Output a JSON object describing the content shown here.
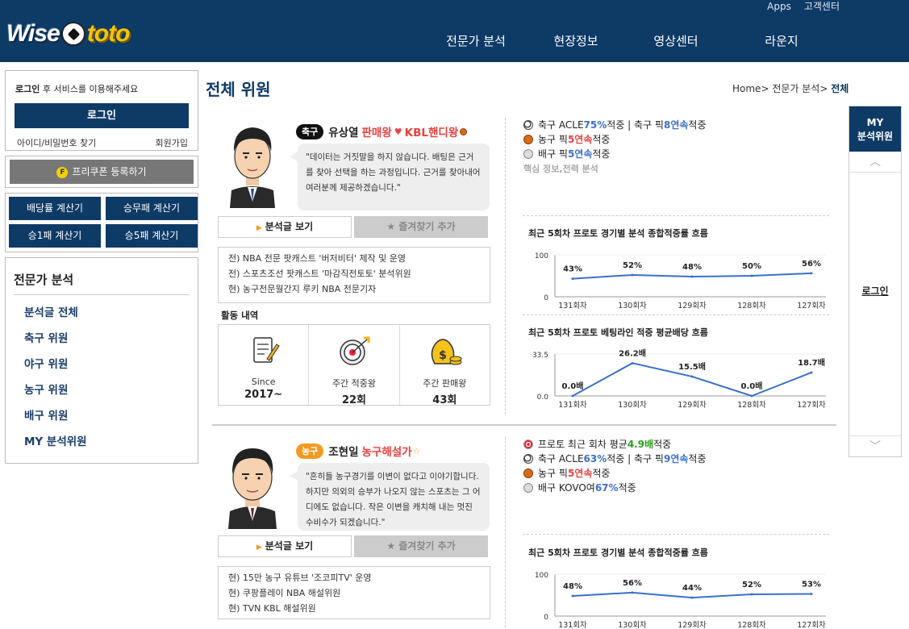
{
  "header": {
    "logo_left": "Wise",
    "logo_right": "toto",
    "top_links": [
      "Apps",
      "고객센터"
    ],
    "nav": [
      "전문가 분석",
      "현장정보",
      "영상센터",
      "라운지"
    ]
  },
  "sidebar": {
    "login_msg_bold": "로그인",
    "login_msg_rest": " 후 서비스를 이용해주세요",
    "login_button": "로그인",
    "find_id": "아이디/비밀번호 찾기",
    "join": "회원가입",
    "coupon_icon": "F",
    "coupon_label": "프리쿠폰 등록하기",
    "calculators": [
      "배당률 계산기",
      "승무패 계산기",
      "승1패 계산기",
      "승5패 계산기"
    ],
    "menu_title": "전문가 분석",
    "menu_items": [
      "분석글 전체",
      "축구 위원",
      "야구 위원",
      "농구 위원",
      "배구 위원",
      "MY 분석위원"
    ]
  },
  "page": {
    "title": "전체 위원",
    "breadcrumb_home": "Home",
    "breadcrumb_mid": "전문가 분석",
    "breadcrumb_current": "전체"
  },
  "my_panel": {
    "title_line1": "MY",
    "title_line2": "분석위원",
    "login": "로그인",
    "up": "︿",
    "down": "﹀"
  },
  "experts": [
    {
      "category": "축구",
      "name": "유상열",
      "tag1": "판매왕",
      "tag2": "KBL핸디왕",
      "quote": "\"데이터는 거짓말을 하지 않습니다. 배팅은 근거를 찾아 선택을 하는 과정입니다. 근거를 찾아내어 여러분께 제공하겠습니다.\"",
      "view_button": "분석글 보기",
      "fav_button": "즐겨찾기 추가",
      "career": [
        "전) NBA 전문 팟캐스트 '버저비터' 제작 및 운영",
        "전) 스포츠조선 팟캐스트 '마감직전토토' 분석위원",
        "현) 농구전문월간지 루키 NBA 전문기자"
      ],
      "activity_title": "활동 내역",
      "activity": [
        {
          "icon": "document-icon",
          "label": "Since",
          "value": "2017~"
        },
        {
          "icon": "target-icon",
          "label": "주간 적중왕",
          "value": "22회"
        },
        {
          "icon": "moneybag-icon",
          "label": "주간 판매왕",
          "value": "43회"
        }
      ],
      "stats": [
        {
          "icon": "soccer",
          "pre": "축구 ACLE ",
          "hl": "75%",
          "hlclass": "blue",
          "mid": " 적중 | 축구 픽 ",
          "hl2": "8연속",
          "post": " 적중"
        },
        {
          "icon": "bball",
          "pre": "농구 픽 ",
          "hl": "5연속",
          "hlclass": "red",
          "mid": " 적중",
          "hl2": "",
          "post": ""
        },
        {
          "icon": "vball",
          "pre": "배구 픽 ",
          "hl": "5연속",
          "hlclass": "blue",
          "mid": " 적중",
          "hl2": "",
          "post": ""
        }
      ],
      "keywords": "핵심 정보,전력 분석",
      "chart_titles": [
        "최근 5회차 프로토 경기별 분석 종합적중률 흐름",
        "최근 5회차 프로토 베팅라인 적중 평균배당 흐름"
      ]
    },
    {
      "category": "농구",
      "name": "조현일",
      "tag1": "농구해설가",
      "tag2": "",
      "quote": "\"흔히들 농구경기를 이변이 없다고 이야기합니다. 하지만 의외의 승부가 나오지 않는 스포츠는 그 어디에도 없습니다. 작은 이변을 캐치해 내는 멋진 수비수가 되겠습니다.\"",
      "view_button": "분석글 보기",
      "fav_button": "즐겨찾기 추가",
      "career": [
        "현) 15만 농구 유튜브 '조코피TV' 운영",
        "현) 쿠팡플레이 NBA 해설위원",
        "현) TVN KBL 해설위원"
      ],
      "stats": [
        {
          "icon": "target",
          "pre": "프로토 최근 회차 평균 ",
          "hl": "4.9배",
          "hlclass": "green",
          "mid": " 적중",
          "hl2": "",
          "post": ""
        },
        {
          "icon": "soccer",
          "pre": "축구 ACLE ",
          "hl": "63%",
          "hlclass": "blue",
          "mid": " 적중 | 축구 픽 ",
          "hl2": "9연속",
          "post": " 적중"
        },
        {
          "icon": "bball",
          "pre": "농구 픽 ",
          "hl": "5연속",
          "hlclass": "red",
          "mid": " 적중",
          "hl2": "",
          "post": ""
        },
        {
          "icon": "vball",
          "pre": "배구 KOVO여 ",
          "hl": "67%",
          "hlclass": "blue",
          "mid": " 적중",
          "hl2": "",
          "post": ""
        }
      ],
      "chart_titles": [
        "최근 5회차 프로토 경기별 분석 종합적중률 흐름"
      ]
    }
  ],
  "chart_data": [
    {
      "type": "line",
      "title": "최근 5회차 프로토 경기별 분석 종합적중률 흐름",
      "categories": [
        "131회차",
        "130회차",
        "129회차",
        "128회차",
        "127회차"
      ],
      "values": [
        43,
        52,
        48,
        50,
        56
      ],
      "labels": [
        "43%",
        "52%",
        "48%",
        "50%",
        "56%"
      ],
      "ylim": [
        0,
        100
      ],
      "yticks": [
        "100",
        "0"
      ],
      "color": "#3b70c9"
    },
    {
      "type": "line",
      "title": "최근 5회차 프로토 베팅라인 적중 평균배당 흐름",
      "categories": [
        "131회차",
        "130회차",
        "129회차",
        "128회차",
        "127회차"
      ],
      "values": [
        0.0,
        26.2,
        15.5,
        0.0,
        18.7
      ],
      "labels": [
        "0.0배",
        "26.2배",
        "15.5배",
        "0.0배",
        "18.7배"
      ],
      "ylim": [
        0,
        33.5
      ],
      "yticks": [
        "33.5",
        "0.0"
      ],
      "color": "#3b70c9"
    },
    {
      "type": "line",
      "title": "최근 5회차 프로토 경기별 분석 종합적중률 흐름",
      "categories": [
        "131회차",
        "130회차",
        "129회차",
        "128회차",
        "127회차"
      ],
      "values": [
        48,
        56,
        44,
        52,
        53
      ],
      "labels": [
        "48%",
        "56%",
        "44%",
        "52%",
        "53%"
      ],
      "ylim": [
        0,
        100
      ],
      "yticks": [
        "100",
        "0"
      ],
      "color": "#3b70c9"
    }
  ]
}
